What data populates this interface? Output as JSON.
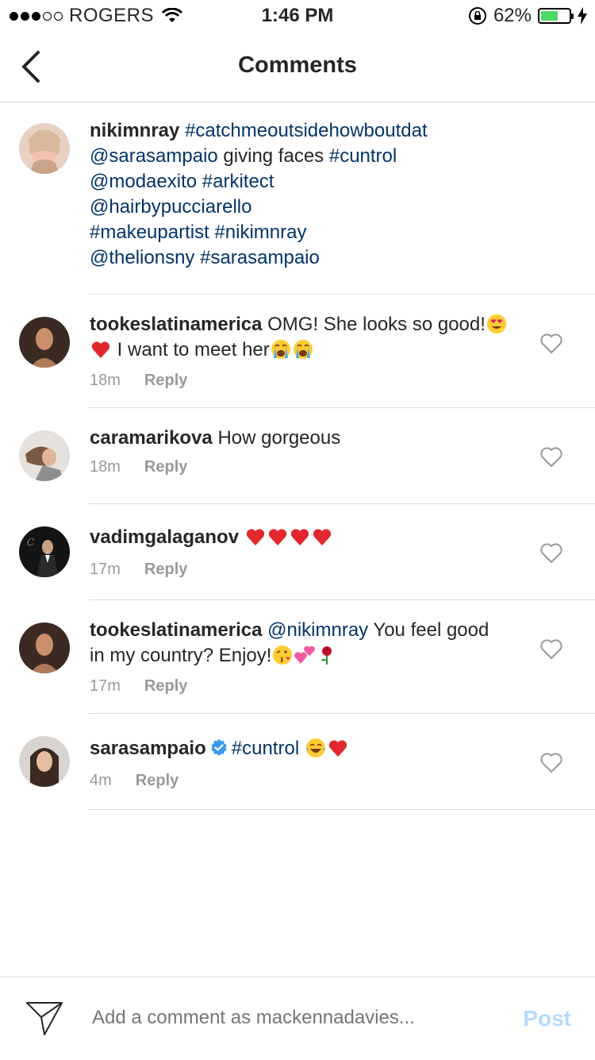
{
  "status_bar": {
    "carrier": "ROGERS",
    "time": "1:46 PM",
    "battery": "62%",
    "battery_level": 0.62
  },
  "nav": {
    "title": "Comments"
  },
  "caption": {
    "username": "nikimnray",
    "lines": [
      [
        "#catchmeoutsidehowboutdat"
      ],
      [
        "@sarasampaio",
        " giving faces ",
        "#cuntrol"
      ],
      [
        "@modaexito",
        " ",
        "#arkitect"
      ],
      [
        "@hairbypucciarello"
      ],
      [
        "#makeupartist",
        " ",
        "#nikimnray"
      ],
      [
        "@thelionsny",
        " ",
        "#sarasampaio"
      ]
    ]
  },
  "comments": [
    {
      "username": "tookeslatinamerica",
      "text_1": "OMG! She looks so good!",
      "text_2": " I want to meet her",
      "emojis": [
        "heart-eyes-emoji",
        "red-heart-emoji",
        "crying-emoji",
        "crying-emoji"
      ],
      "time": "18m",
      "reply": "Reply"
    },
    {
      "username": "caramarikova",
      "text": "How gorgeous",
      "time": "18m",
      "reply": "Reply"
    },
    {
      "username": "vadimgalaganov",
      "emojis": [
        "red-heart-emoji",
        "red-heart-emoji",
        "red-heart-emoji",
        "red-heart-emoji"
      ],
      "time": "17m",
      "reply": "Reply"
    },
    {
      "username": "tookeslatinamerica",
      "mention": "@nikimnray",
      "text": " You feel good in my country? Enjoy!",
      "emojis": [
        "kiss-emoji",
        "two-hearts-emoji",
        "rose-emoji"
      ],
      "time": "17m",
      "reply": "Reply"
    },
    {
      "username": "sarasampaio",
      "verified": true,
      "tag": "#cuntrol",
      "emojis": [
        "laughing-emoji",
        "red-heart-emoji"
      ],
      "time": "4m",
      "reply": "Reply"
    }
  ],
  "composer": {
    "placeholder": "Add a comment as mackennadavies...",
    "post_label": "Post"
  },
  "colors": {
    "link": "#003569",
    "muted": "#999999",
    "post_disabled": "#b3dbff",
    "divider": "#dbdbdb"
  }
}
